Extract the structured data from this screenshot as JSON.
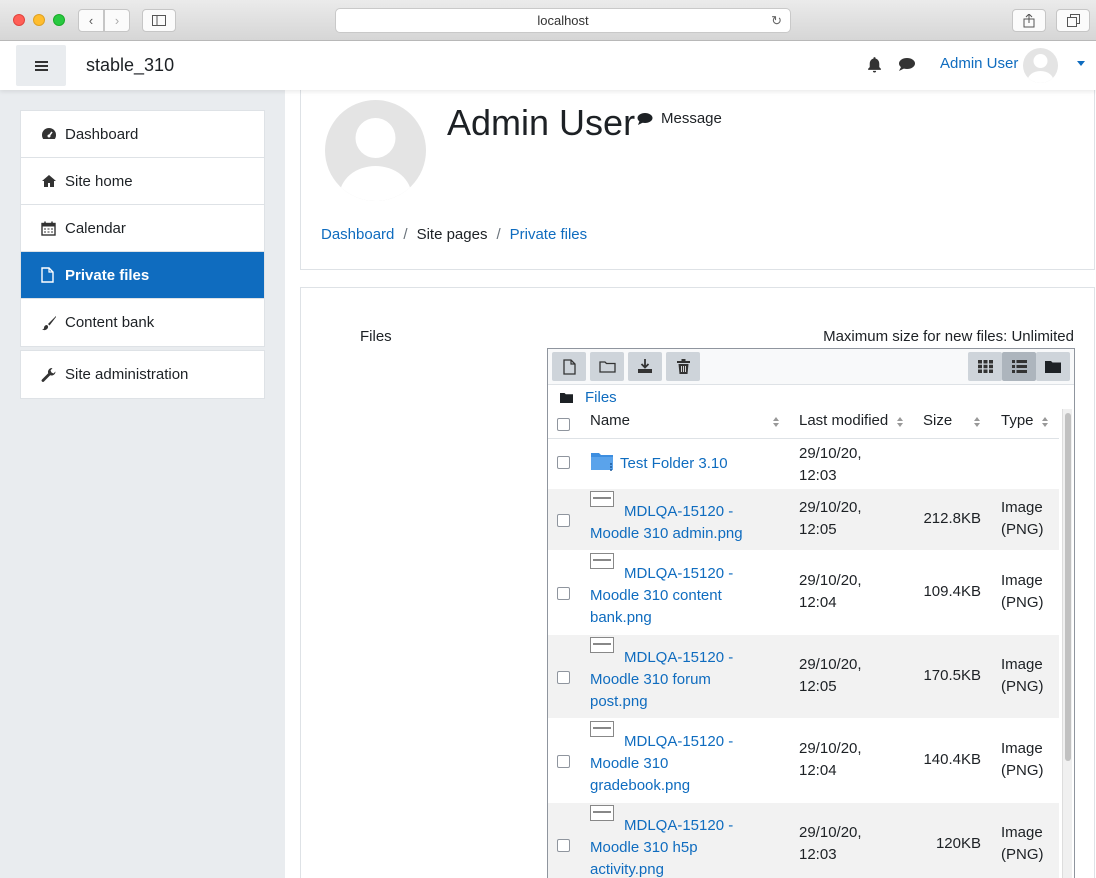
{
  "browser": {
    "url": "localhost"
  },
  "navbar": {
    "site_name": "stable_310",
    "user_name": "Admin User"
  },
  "drawer": {
    "items": [
      {
        "label": "Dashboard",
        "icon": "dashboard-icon"
      },
      {
        "label": "Site home",
        "icon": "home-icon"
      },
      {
        "label": "Calendar",
        "icon": "calendar-icon"
      },
      {
        "label": "Private files",
        "icon": "file-icon",
        "active": true
      },
      {
        "label": "Content bank",
        "icon": "paintbrush-icon"
      }
    ],
    "admin_item": {
      "label": "Site administration",
      "icon": "wrench-icon"
    }
  },
  "profile": {
    "full_name": "Admin User",
    "message_label": "Message"
  },
  "breadcrumb": {
    "items": [
      "Dashboard",
      "Site pages",
      "Private files"
    ]
  },
  "files": {
    "label": "Files",
    "max_size": "Maximum size for new files: Unlimited",
    "path_root": "Files",
    "columns": {
      "name": "Name",
      "modified": "Last modified",
      "size": "Size",
      "type": "Type"
    },
    "rows": [
      {
        "name": "Test Folder 3.10",
        "modified": "29/10/20, 12:03",
        "size": "",
        "type": "",
        "kind": "folder"
      },
      {
        "name": "MDLQA-15120 - Moodle 310 admin.png",
        "modified": "29/10/20, 12:05",
        "size": "212.8KB",
        "type": "Image (PNG)",
        "kind": "image"
      },
      {
        "name": "MDLQA-15120 - Moodle 310 content bank.png",
        "modified": "29/10/20, 12:04",
        "size": "109.4KB",
        "type": "Image (PNG)",
        "kind": "image"
      },
      {
        "name": "MDLQA-15120 - Moodle 310 forum post.png",
        "modified": "29/10/20, 12:05",
        "size": "170.5KB",
        "type": "Image (PNG)",
        "kind": "image"
      },
      {
        "name": "MDLQA-15120 - Moodle 310 gradebook.png",
        "modified": "29/10/20, 12:04",
        "size": "140.4KB",
        "type": "Image (PNG)",
        "kind": "image"
      },
      {
        "name": "MDLQA-15120 - Moodle 310 h5p activity.png",
        "modified": "29/10/20, 12:03",
        "size": "120KB",
        "type": "Image (PNG)",
        "kind": "image"
      }
    ]
  },
  "colors": {
    "primary": "#0f6cbf",
    "drawer_bg": "#e9ecef"
  }
}
